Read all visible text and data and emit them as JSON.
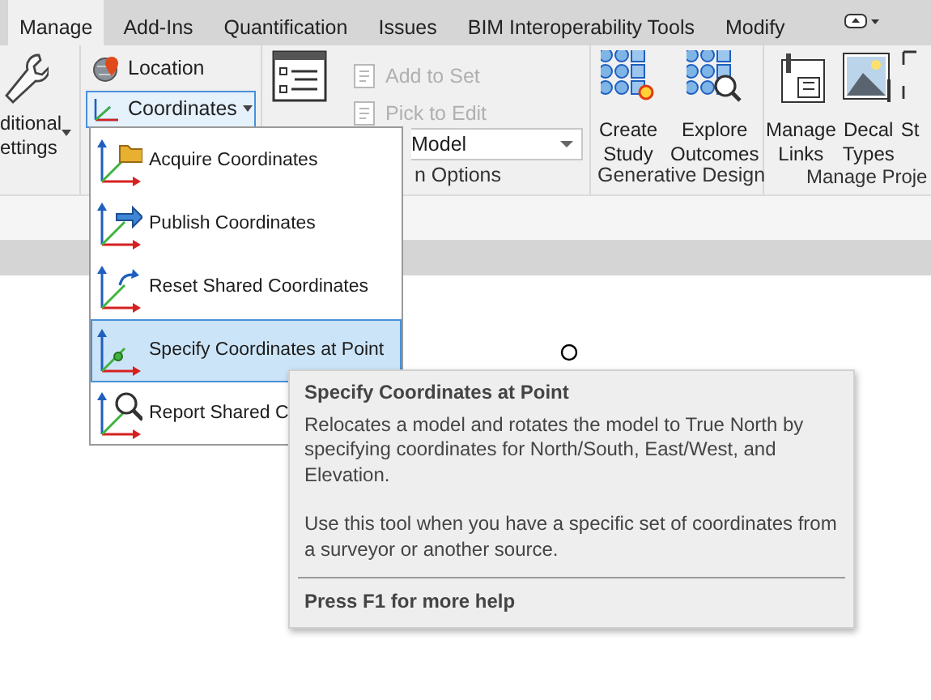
{
  "tabs": [
    {
      "label": "Manage",
      "selected": true
    },
    {
      "label": "Add-Ins",
      "selected": false
    },
    {
      "label": "Quantification",
      "selected": false
    },
    {
      "label": "Issues",
      "selected": false
    },
    {
      "label": "BIM Interoperability Tools",
      "selected": false
    },
    {
      "label": "Modify",
      "selected": false
    }
  ],
  "settings_button": {
    "lines": [
      "ditional",
      "ettings"
    ]
  },
  "location_button": {
    "label": "Location"
  },
  "coordinates_button": {
    "label": "Coordinates",
    "selected": true
  },
  "design_options": {
    "add_to_set": {
      "label": "Add to Set",
      "disabled": true
    },
    "pick_to_edit": {
      "label": "Pick to Edit",
      "disabled": true
    },
    "combo_value": "Model",
    "panel_label": "n Options"
  },
  "generative_design": {
    "buttons": [
      {
        "lines": [
          "Create",
          "Study"
        ],
        "kind": "create"
      },
      {
        "lines": [
          "Explore",
          "Outcomes"
        ],
        "kind": "explore"
      }
    ],
    "panel_label": "Generative Design"
  },
  "manage_project": {
    "buttons": [
      {
        "lines": [
          "Manage",
          "Links"
        ],
        "kind": "links"
      },
      {
        "lines": [
          "Decal",
          "Types"
        ],
        "kind": "decal"
      },
      {
        "lines": [
          "St"
        ],
        "kind": "cut"
      }
    ],
    "panel_label": "Manage Proje"
  },
  "coordinates_menu": {
    "items": [
      {
        "label": "Acquire Coordinates",
        "kind": "acquire",
        "selected": false
      },
      {
        "label": "Publish Coordinates",
        "kind": "publish",
        "selected": false
      },
      {
        "label": "Reset Shared Coordinates",
        "kind": "reset",
        "selected": false
      },
      {
        "label": "Specify Coordinates at Point",
        "kind": "specify",
        "selected": true
      },
      {
        "label": "Report Shared C",
        "kind": "report",
        "selected": false
      }
    ]
  },
  "tooltip": {
    "title": "Specify Coordinates at Point",
    "paragraphs": [
      "Relocates a model and rotates the model to True North by specifying coordinates for North/South, East/West, and Elevation.",
      "Use this tool when you have a specific set of coordinates from a surveyor or another source."
    ],
    "footer": "Press F1 for more help"
  }
}
